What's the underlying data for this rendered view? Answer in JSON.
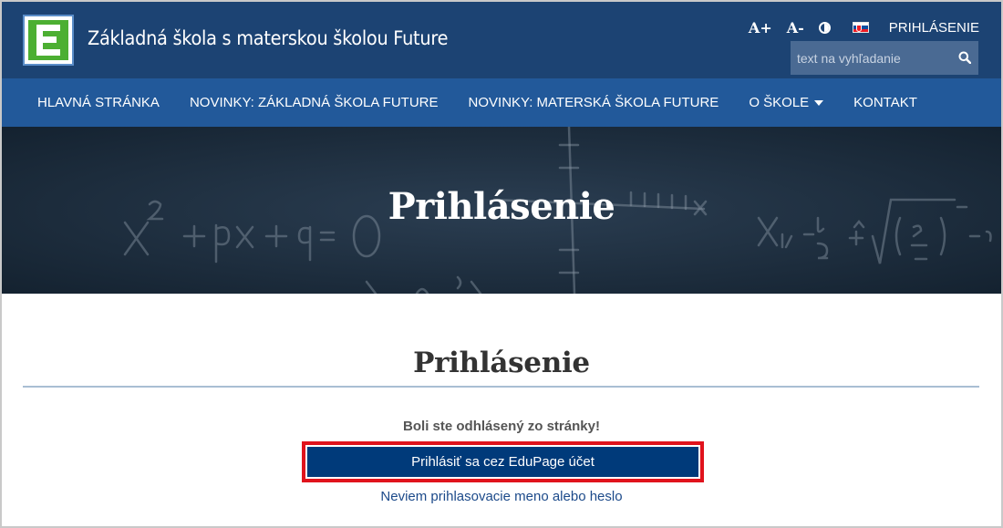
{
  "header": {
    "school_name": "Základná škola s materskou školou Future",
    "font_increase": "A+",
    "font_decrease": "A-",
    "login_link": "PRIHLÁSENIE",
    "search_placeholder": "text na vyhľadanie"
  },
  "nav": {
    "items": [
      {
        "label": "HLAVNÁ STRÁNKA"
      },
      {
        "label": "NOVINKY: ZÁKLADNÁ ŠKOLA FUTURE"
      },
      {
        "label": "NOVINKY: MATERSKÁ ŠKOLA FUTURE"
      },
      {
        "label": "O ŠKOLE"
      },
      {
        "label": "KONTAKT"
      }
    ]
  },
  "hero": {
    "title": "Prihlásenie"
  },
  "main": {
    "title": "Prihlásenie",
    "logout_message": "Boli ste odhlásený zo stránky!",
    "edupage_button": "Prihlásiť sa cez EduPage účet",
    "forgot_link": "Neviem prihlasovacie meno alebo heslo"
  },
  "colors": {
    "header_bg": "#1c4373",
    "nav_bg": "#22599a",
    "button_bg": "#003a7a",
    "highlight_border": "#e0131c",
    "logo_green": "#4caf32"
  }
}
